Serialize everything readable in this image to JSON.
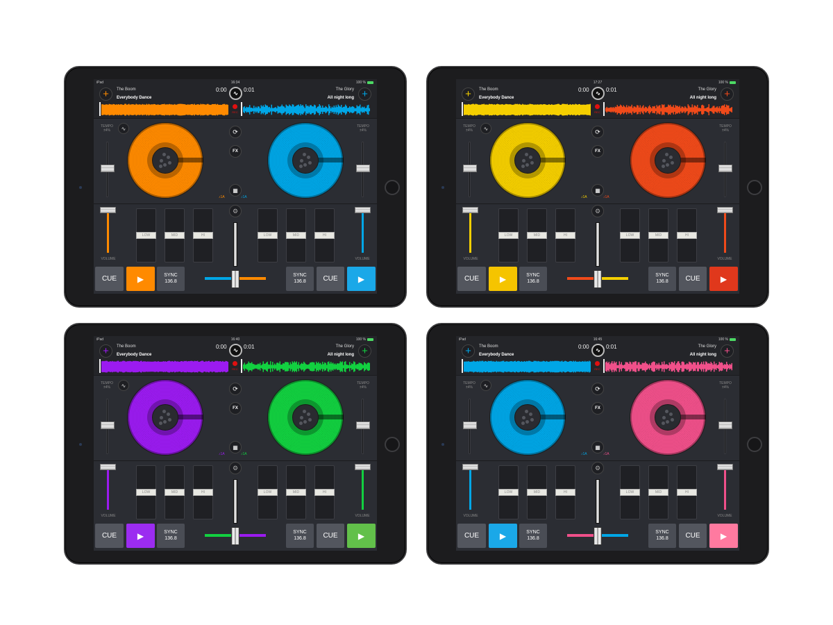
{
  "labels": {
    "tempo": "TEMPO",
    "tempo_range": "±4%",
    "volume": "VOLUME",
    "low": "LOW",
    "mid": "MID",
    "hi": "HI",
    "cue": "CUE",
    "sync": "SYNC",
    "bpm": "136.8",
    "fx": "FX",
    "rec": "REC"
  },
  "devices": [
    {
      "status": {
        "carrier": "iPad",
        "time": "16:34",
        "battery": "100 %"
      },
      "left": {
        "artist": "The Boom",
        "title": "Everybody Dance",
        "time": "0:00",
        "key": "1A",
        "color": "#ff8a00",
        "play_color": "#ff8a00"
      },
      "right": {
        "artist": "The Glory",
        "title": "All night long",
        "time": "0:01",
        "key": "1A",
        "color": "#00a6e6",
        "play_color": "#1aa8e8"
      }
    },
    {
      "status": {
        "carrier": "",
        "time": "17:27",
        "battery": "100 %"
      },
      "left": {
        "artist": "The Boom",
        "title": "Everybody Dance",
        "time": "0:00",
        "key": "1A",
        "color": "#f5cf00",
        "play_color": "#f5c400"
      },
      "right": {
        "artist": "The Glory",
        "title": "All night long",
        "time": "0:01",
        "key": "1A",
        "color": "#f04a1a",
        "play_color": "#e0381c"
      }
    },
    {
      "status": {
        "carrier": "iPad",
        "time": "16:40",
        "battery": "100 %"
      },
      "left": {
        "artist": "The Boom",
        "title": "Everybody Dance",
        "time": "0:00",
        "key": "1A",
        "color": "#9b1bf0",
        "play_color": "#9b2cf0"
      },
      "right": {
        "artist": "The Glory",
        "title": "All night long",
        "time": "0:01",
        "key": "1A",
        "color": "#12d040",
        "play_color": "#62c04a"
      }
    },
    {
      "status": {
        "carrier": "iPad",
        "time": "16:45",
        "battery": "100 %"
      },
      "left": {
        "artist": "The Boom",
        "title": "Everybody Dance",
        "time": "0:00",
        "key": "1A",
        "color": "#00a6e6",
        "play_color": "#1aa8e8"
      },
      "right": {
        "artist": "The Glory",
        "title": "All night long",
        "time": "0:01",
        "key": "1A",
        "color": "#f0508a",
        "play_color": "#ff7aa0"
      }
    }
  ]
}
